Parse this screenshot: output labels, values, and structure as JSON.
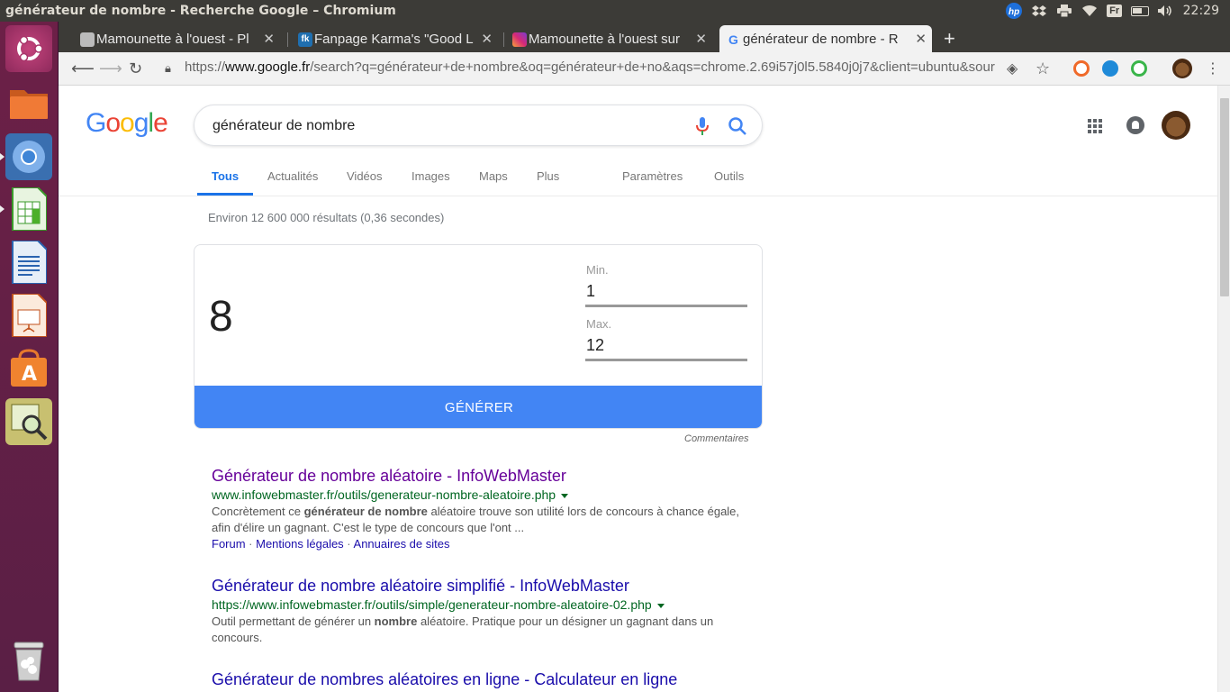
{
  "os": {
    "window_title": "générateur de nombre - Recherche Google – Chromium",
    "clock": "22:29",
    "keyboard_layout": "Fr",
    "tray_icons": [
      "hp-icon",
      "dropbox-icon",
      "printer-icon",
      "wifi-icon",
      "keyboard-layout-icon",
      "battery-icon",
      "volume-icon"
    ],
    "launcher_items": [
      "ubuntu-dash-icon",
      "files-icon",
      "chromium-icon",
      "libreoffice-calc-icon",
      "libreoffice-writer-icon",
      "libreoffice-impress-icon",
      "software-center-icon",
      "system-monitor-icon",
      "trash-icon"
    ]
  },
  "browser": {
    "tabs": [
      {
        "label": "Mamounette à l'ouest - Pl",
        "icon": "printer-tab-icon",
        "active": false
      },
      {
        "label": "Fanpage Karma's \"Good L",
        "icon": "fk-tab-icon",
        "active": false
      },
      {
        "label": "Mamounette à l'ouest sur",
        "icon": "instagram-tab-icon",
        "active": false
      },
      {
        "label": "générateur de nombre - R",
        "icon": "google-tab-icon",
        "active": true
      }
    ],
    "url": {
      "scheme": "https://",
      "host": "www.google.fr",
      "rest": "/search?q=générateur+de+nombre&oq=générateur+de+no&aqs=chrome.2.69i57j0l5.5840j0j7&client=ubuntu&source..."
    }
  },
  "google": {
    "logo": "Google",
    "query": "générateur de nombre",
    "nav_tabs": [
      "Tous",
      "Actualités",
      "Vidéos",
      "Images",
      "Maps",
      "Plus",
      "Paramètres",
      "Outils"
    ],
    "stats": "Environ 12 600 000 résultats (0,36 secondes)",
    "rng": {
      "result": "8",
      "min_label": "Min.",
      "min_value": "1",
      "max_label": "Max.",
      "max_value": "12",
      "button": "GÉNÉRER",
      "feedback": "Commentaires"
    },
    "results": [
      {
        "title": "Générateur de nombre aléatoire - InfoWebMaster",
        "url": "www.infowebmaster.fr/outils/generateur-nombre-aleatoire.php",
        "snippet_parts": [
          "Concrètement ce ",
          "générateur de nombre",
          " aléatoire trouve son utilité lors de concours à chance égale, afin d'élire un gagnant. C'est le type de concours que l'ont ..."
        ],
        "sitelinks": [
          "Forum",
          "Mentions légales",
          "Annuaires de sites"
        ]
      },
      {
        "title": "Générateur de nombre aléatoire simplifié - InfoWebMaster",
        "url": "https://www.infowebmaster.fr/outils/simple/generateur-nombre-aleatoire-02.php",
        "snippet_parts": [
          "Outil permettant de générer un ",
          "nombre",
          " aléatoire. Pratique pour un désigner un gagnant dans un concours."
        ]
      },
      {
        "title": "Générateur de nombres aléatoires en ligne - Calculateur en ligne"
      }
    ]
  }
}
